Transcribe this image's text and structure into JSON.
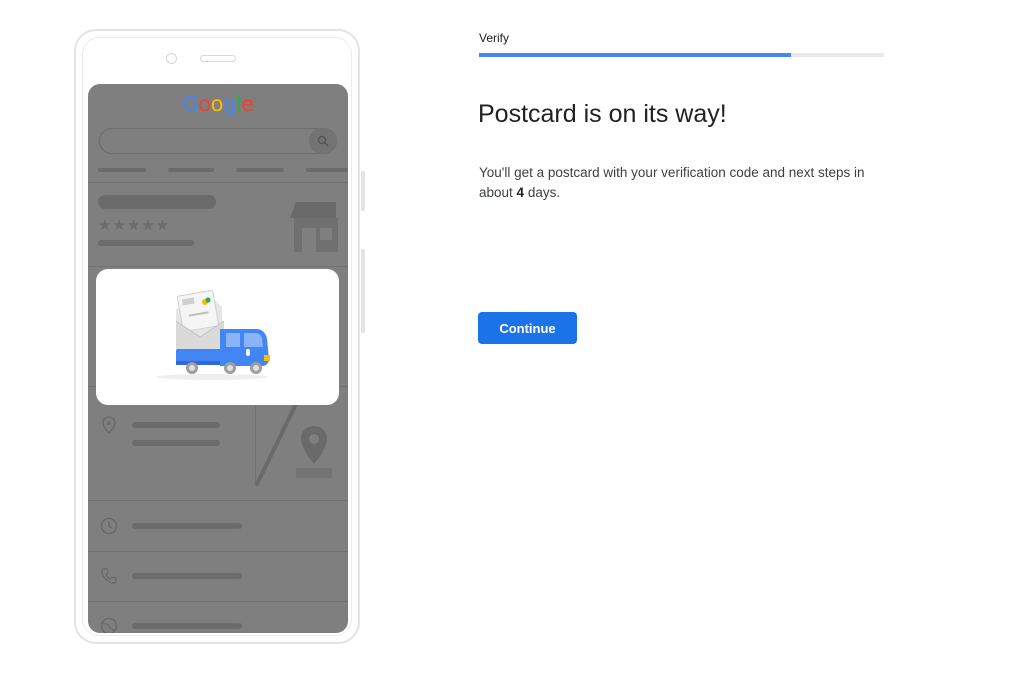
{
  "phone": {
    "logo_letters": [
      {
        "ch": "G",
        "color": "#4285f4"
      },
      {
        "ch": "o",
        "color": "#ea4335"
      },
      {
        "ch": "o",
        "color": "#fbbc05"
      },
      {
        "ch": "g",
        "color": "#4285f4"
      },
      {
        "ch": "l",
        "color": "#34a853"
      },
      {
        "ch": "e",
        "color": "#ea4335"
      }
    ],
    "rating_stars": "★★★★★",
    "illustration": "postcard-delivery-truck"
  },
  "step": {
    "label": "Verify",
    "progress": 0.77,
    "accent_color": "#4285f4"
  },
  "main": {
    "heading": "Postcard is on its way!",
    "description_prefix": "You'll get a postcard with your verification code and next steps in about ",
    "days": "4",
    "description_suffix": " days.",
    "continue_label": "Continue",
    "button_color": "#1a73e8"
  }
}
